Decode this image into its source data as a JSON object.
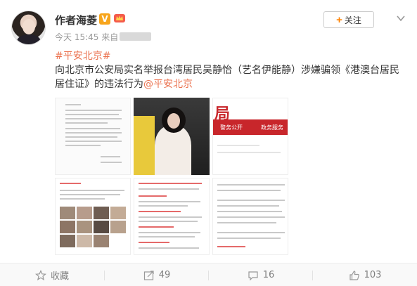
{
  "author": {
    "name": "作者海菱",
    "vip_badge": "V"
  },
  "follow_button": {
    "label": "关注"
  },
  "meta": {
    "time": "今天 15:45 来自"
  },
  "post": {
    "hashtag": "#平安北京#",
    "text": "向北京市公安局实名举报台湾居民吴静怡（艺名伊能静）涉嫌骗领《港澳台居民居住证》的违法行为",
    "mention": "@平安北京"
  },
  "actions": {
    "favorite": "收藏",
    "repost_count": "49",
    "comment_count": "16",
    "like_count": "103"
  },
  "thumb_texts": {
    "police_logo": "局",
    "nav_left": "警务公开",
    "nav_right": "政务服务"
  },
  "colors": {
    "accent": "#eb7350",
    "follow_plus": "#ff8200",
    "vip": "#f7a51c"
  }
}
